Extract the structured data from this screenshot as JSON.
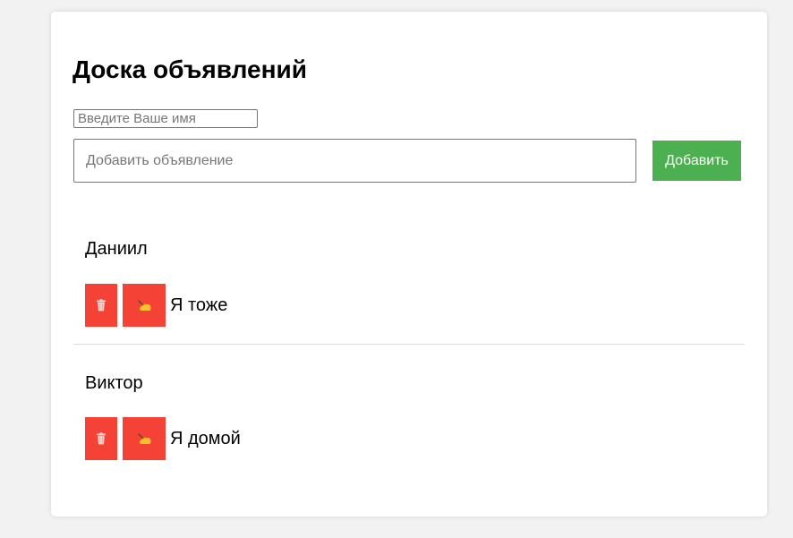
{
  "board": {
    "title": "Доска объявлений",
    "name_placeholder": "Введите Ваше имя",
    "ad_placeholder": "Добавить объявление",
    "add_label": "Добавить"
  },
  "posts": [
    {
      "author": "Даниил",
      "text": "Я тоже",
      "delete_icon": "trash-icon",
      "edit_icon": "writing-hand-icon"
    },
    {
      "author": "Виктор",
      "text": "Я домой",
      "delete_icon": "trash-icon",
      "edit_icon": "writing-hand-icon"
    }
  ],
  "colors": {
    "accent_add": "#4caf50",
    "accent_danger": "#f44336",
    "background": "#f2f2f2"
  }
}
